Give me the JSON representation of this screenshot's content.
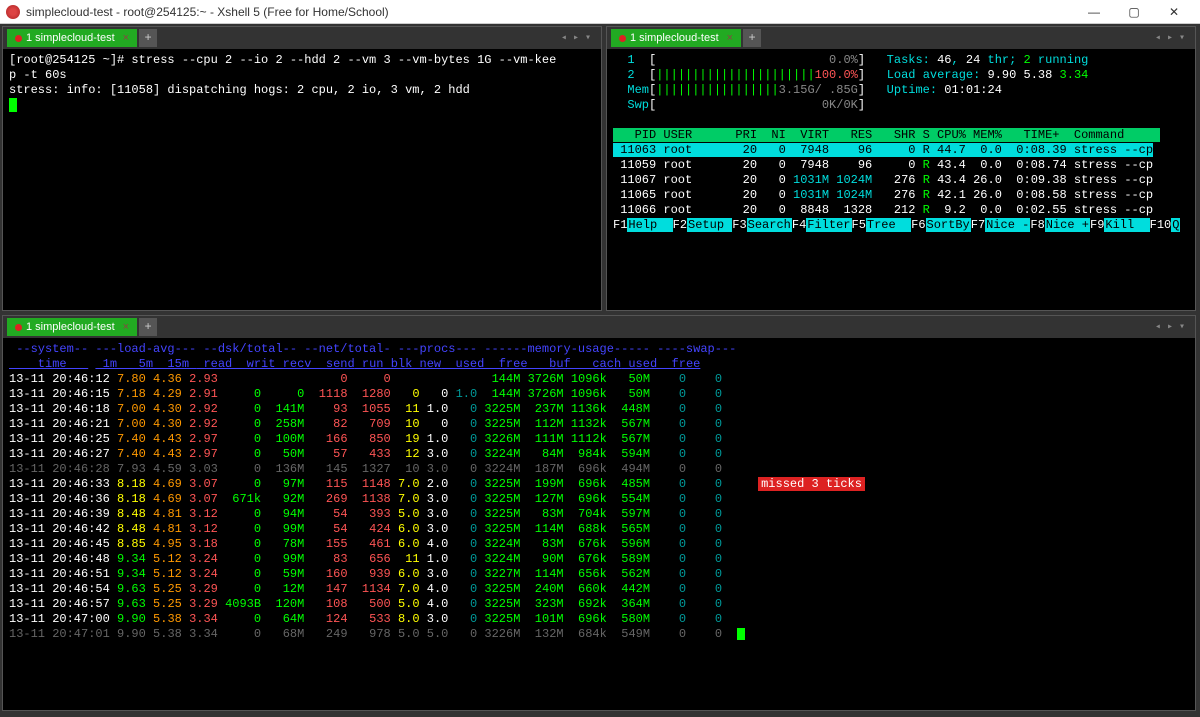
{
  "titlebar": {
    "text": "simplecloud-test - root@254125:~ - Xshell 5 (Free for Home/School)",
    "min": "—",
    "max": "▢",
    "close": "✕"
  },
  "tabs": {
    "label1": "1 simplecloud-test",
    "add": "+",
    "nav": "◂  ▸  ▾"
  },
  "term1": {
    "line1": "[root@254125 ~]# stress --cpu 2 --io 2 --hdd 2 --vm 3 --vm-bytes 1G --vm-kee",
    "line2": "p -t 60s",
    "line3": "stress: info: [11058] dispatching hogs: 2 cpu, 2 io, 3 vm, 2 hdd"
  },
  "htop": {
    "cpu1_label": "1",
    "cpu1_bar": "[",
    "cpu1_end": "0.0%",
    "cpu1_close": "]",
    "cpu2_label": "2",
    "cpu2_bar": "[",
    "cpu2_fill": "||||||||||||||||||||||",
    "cpu2_end": "100.0%",
    "cpu2_close": "]",
    "mem_label": "Mem",
    "mem_bar": "[",
    "mem_fill": "|||||||||||||||||",
    "mem_end": "3.15G/ .85G",
    "mem_close": "]",
    "swp_label": "Swp",
    "swp_bar": "[",
    "swp_end": "0K/0K",
    "swp_close": "]",
    "tasks": "Tasks: ",
    "tasks_v": "46",
    "tasks_c": ", ",
    "tasks_thr": "24",
    "tasks_t": " thr; ",
    "tasks_r": "2",
    "tasks_rt": " running",
    "load": "Load average: ",
    "l1": "9.90",
    "l2": "5.38",
    "l3": "3.34",
    "uptime": "Uptime: ",
    "uptime_v": "01:01:24",
    "header": "   PID USER      PRI  NI  VIRT   RES   SHR S CPU% MEM%   TIME+  Command     ",
    "rows": [
      {
        "hl": true,
        "t": " 11063 root       20   0  7948    96     0 R 44.7  0.0  0:08.39 stress --cp"
      },
      {
        "hl": false,
        "t": " 11059 root       20   0  7948    96     0 R 43.4  0.0  0:08.74 stress --cp"
      },
      {
        "hl": false,
        "t": " 11067 root       20   0 1031M 1024M   276 R 43.4 26.0  0:09.38 stress --cp"
      },
      {
        "hl": false,
        "t": " 11065 root       20   0 1031M 1024M   276 R 42.1 26.0  0:08.58 stress --cp"
      },
      {
        "hl": false,
        "t": " 11066 root       20   0  8848  1328   212 R  9.2  0.0  0:02.55 stress --cp"
      }
    ],
    "fn": [
      {
        "k": "F1",
        "l": "Help  "
      },
      {
        "k": "F2",
        "l": "Setup "
      },
      {
        "k": "F3",
        "l": "Search"
      },
      {
        "k": "F4",
        "l": "Filter"
      },
      {
        "k": "F5",
        "l": "Tree  "
      },
      {
        "k": "F6",
        "l": "SortBy"
      },
      {
        "k": "F7",
        "l": "Nice -"
      },
      {
        "k": "F8",
        "l": "Nice +"
      },
      {
        "k": "F9",
        "l": "Kill  "
      },
      {
        "k": "F10",
        "l": "Q"
      }
    ]
  },
  "dstat": {
    "hdr1": " --system-- ---load-avg--- --dsk/total-- --net/total- ---procs--- ------memory-usage----- ----swap---",
    "hdr2p1": "    time   ",
    "hdr2p2": "| 1m   5m  15m ",
    "hdr2p3": "| read  writ",
    "hdr2p4": "| recv  send",
    "hdr2p5": "|run blk new",
    "hdr2p6": "| used  free  buf  cach",
    "hdr2p7": "|used  free",
    "rows": [
      {
        "t": "13-11 20:46:12",
        "l1": "7.80",
        "l5": "4.36",
        "l15": "2.93",
        "rd": "",
        "wr": "",
        "rc": "0",
        "sn": "0",
        "rn": "",
        "bk": "",
        "nw": "",
        "us": "144M",
        "fr": "3726M",
        "bf": "1096k",
        "ca": "50M",
        "su": "0",
        "sf": "0"
      },
      {
        "t": "13-11 20:46:15",
        "l1": "7.18",
        "l5": "4.29",
        "l15": "2.91",
        "rd": "0",
        "wr": "0",
        "rc": "1118",
        "sn": "1280",
        "rn": "0",
        "bk": "0",
        "nw": "1.0",
        "us": "144M",
        "fr": "3726M",
        "bf": "1096k",
        "ca": "50M",
        "su": "0",
        "sf": "0"
      },
      {
        "t": "13-11 20:46:18",
        "l1": "7.00",
        "l5": "4.30",
        "l15": "2.92",
        "rd": "0",
        "wr": "141M",
        "rc": "93",
        "sn": "1055",
        "rn": "11",
        "bk": "1.0",
        "nw": "0",
        "us": "3225M",
        "fr": "237M",
        "bf": "1136k",
        "ca": "448M",
        "su": "0",
        "sf": "0"
      },
      {
        "t": "13-11 20:46:21",
        "l1": "7.00",
        "l5": "4.30",
        "l15": "2.92",
        "rd": "0",
        "wr": "258M",
        "rc": "82",
        "sn": "709",
        "rn": "10",
        "bk": "0",
        "nw": "0",
        "us": "3225M",
        "fr": "112M",
        "bf": "1132k",
        "ca": "567M",
        "su": "0",
        "sf": "0"
      },
      {
        "t": "13-11 20:46:25",
        "l1": "7.40",
        "l5": "4.43",
        "l15": "2.97",
        "rd": "0",
        "wr": "100M",
        "rc": "166",
        "sn": "850",
        "rn": "19",
        "bk": "1.0",
        "nw": "0",
        "us": "3226M",
        "fr": "111M",
        "bf": "1112k",
        "ca": "567M",
        "su": "0",
        "sf": "0"
      },
      {
        "t": "13-11 20:46:27",
        "l1": "7.40",
        "l5": "4.43",
        "l15": "2.97",
        "rd": "0",
        "wr": "50M",
        "rc": "57",
        "sn": "433",
        "rn": "12",
        "bk": "3.0",
        "nw": "0",
        "us": "3224M",
        "fr": "84M",
        "bf": "984k",
        "ca": "594M",
        "su": "0",
        "sf": "0"
      },
      {
        "dim": true,
        "t": "13-11 20:46:28",
        "l1": "7.93",
        "l5": "4.59",
        "l15": "3.03",
        "rd": "0",
        "wr": "136M",
        "rc": "145",
        "sn": "1327",
        "rn": "10",
        "bk": "3.0",
        "nw": "0",
        "us": "3224M",
        "fr": "187M",
        "bf": "696k",
        "ca": "494M",
        "su": "0",
        "sf": "0"
      },
      {
        "t": "13-11 20:46:33",
        "l1": "8.18",
        "l5": "4.69",
        "l15": "3.07",
        "rd": "0",
        "wr": "97M",
        "rc": "115",
        "sn": "1148",
        "rn": "7.0",
        "bk": "2.0",
        "nw": "0",
        "us": "3225M",
        "fr": "199M",
        "bf": "696k",
        "ca": "485M",
        "su": "0",
        "sf": "0",
        "missed": "missed 3 ticks"
      },
      {
        "t": "13-11 20:46:36",
        "l1": "8.18",
        "l5": "4.69",
        "l15": "3.07",
        "rd": "671k",
        "wr": "92M",
        "rc": "269",
        "sn": "1138",
        "rn": "7.0",
        "bk": "3.0",
        "nw": "0",
        "us": "3225M",
        "fr": "127M",
        "bf": "696k",
        "ca": "554M",
        "su": "0",
        "sf": "0"
      },
      {
        "t": "13-11 20:46:39",
        "l1": "8.48",
        "l5": "4.81",
        "l15": "3.12",
        "rd": "0",
        "wr": "94M",
        "rc": "54",
        "sn": "393",
        "rn": "5.0",
        "bk": "3.0",
        "nw": "0",
        "us": "3225M",
        "fr": "83M",
        "bf": "704k",
        "ca": "597M",
        "su": "0",
        "sf": "0"
      },
      {
        "t": "13-11 20:46:42",
        "l1": "8.48",
        "l5": "4.81",
        "l15": "3.12",
        "rd": "0",
        "wr": "99M",
        "rc": "54",
        "sn": "424",
        "rn": "6.0",
        "bk": "3.0",
        "nw": "0",
        "us": "3225M",
        "fr": "114M",
        "bf": "688k",
        "ca": "565M",
        "su": "0",
        "sf": "0"
      },
      {
        "t": "13-11 20:46:45",
        "l1": "8.85",
        "l5": "4.95",
        "l15": "3.18",
        "rd": "0",
        "wr": "78M",
        "rc": "155",
        "sn": "461",
        "rn": "6.0",
        "bk": "4.0",
        "nw": "0",
        "us": "3224M",
        "fr": "83M",
        "bf": "676k",
        "ca": "596M",
        "su": "0",
        "sf": "0"
      },
      {
        "t": "13-11 20:46:48",
        "l1": "9.34",
        "l5": "5.12",
        "l15": "3.24",
        "rd": "0",
        "wr": "99M",
        "rc": "83",
        "sn": "656",
        "rn": "11",
        "bk": "1.0",
        "nw": "0",
        "us": "3224M",
        "fr": "90M",
        "bf": "676k",
        "ca": "589M",
        "su": "0",
        "sf": "0"
      },
      {
        "t": "13-11 20:46:51",
        "l1": "9.34",
        "l5": "5.12",
        "l15": "3.24",
        "rd": "0",
        "wr": "59M",
        "rc": "160",
        "sn": "939",
        "rn": "6.0",
        "bk": "3.0",
        "nw": "0",
        "us": "3227M",
        "fr": "114M",
        "bf": "656k",
        "ca": "562M",
        "su": "0",
        "sf": "0"
      },
      {
        "t": "13-11 20:46:54",
        "l1": "9.63",
        "l5": "5.25",
        "l15": "3.29",
        "rd": "0",
        "wr": "12M",
        "rc": "147",
        "sn": "1134",
        "rn": "7.0",
        "bk": "4.0",
        "nw": "0",
        "us": "3225M",
        "fr": "240M",
        "bf": "660k",
        "ca": "442M",
        "su": "0",
        "sf": "0"
      },
      {
        "t": "13-11 20:46:57",
        "l1": "9.63",
        "l5": "5.25",
        "l15": "3.29",
        "rd": "4093B",
        "wr": "120M",
        "rc": "108",
        "sn": "500",
        "rn": "5.0",
        "bk": "4.0",
        "nw": "0",
        "us": "3225M",
        "fr": "323M",
        "bf": "692k",
        "ca": "364M",
        "su": "0",
        "sf": "0"
      },
      {
        "t": "13-11 20:47:00",
        "l1": "9.90",
        "l5": "5.38",
        "l15": "3.34",
        "rd": "0",
        "wr": "64M",
        "rc": "124",
        "sn": "533",
        "rn": "8.0",
        "bk": "3.0",
        "nw": "0",
        "us": "3225M",
        "fr": "101M",
        "bf": "696k",
        "ca": "580M",
        "su": "0",
        "sf": "0"
      },
      {
        "dim": true,
        "t": "13-11 20:47:01",
        "l1": "9.90",
        "l5": "5.38",
        "l15": "3.34",
        "rd": "0",
        "wr": "68M",
        "rc": "249",
        "sn": "978",
        "rn": "5.0",
        "bk": "5.0",
        "nw": "0",
        "us": "3226M",
        "fr": "132M",
        "bf": "684k",
        "ca": "549M",
        "su": "0",
        "sf": "0",
        "cursor": true
      }
    ]
  }
}
